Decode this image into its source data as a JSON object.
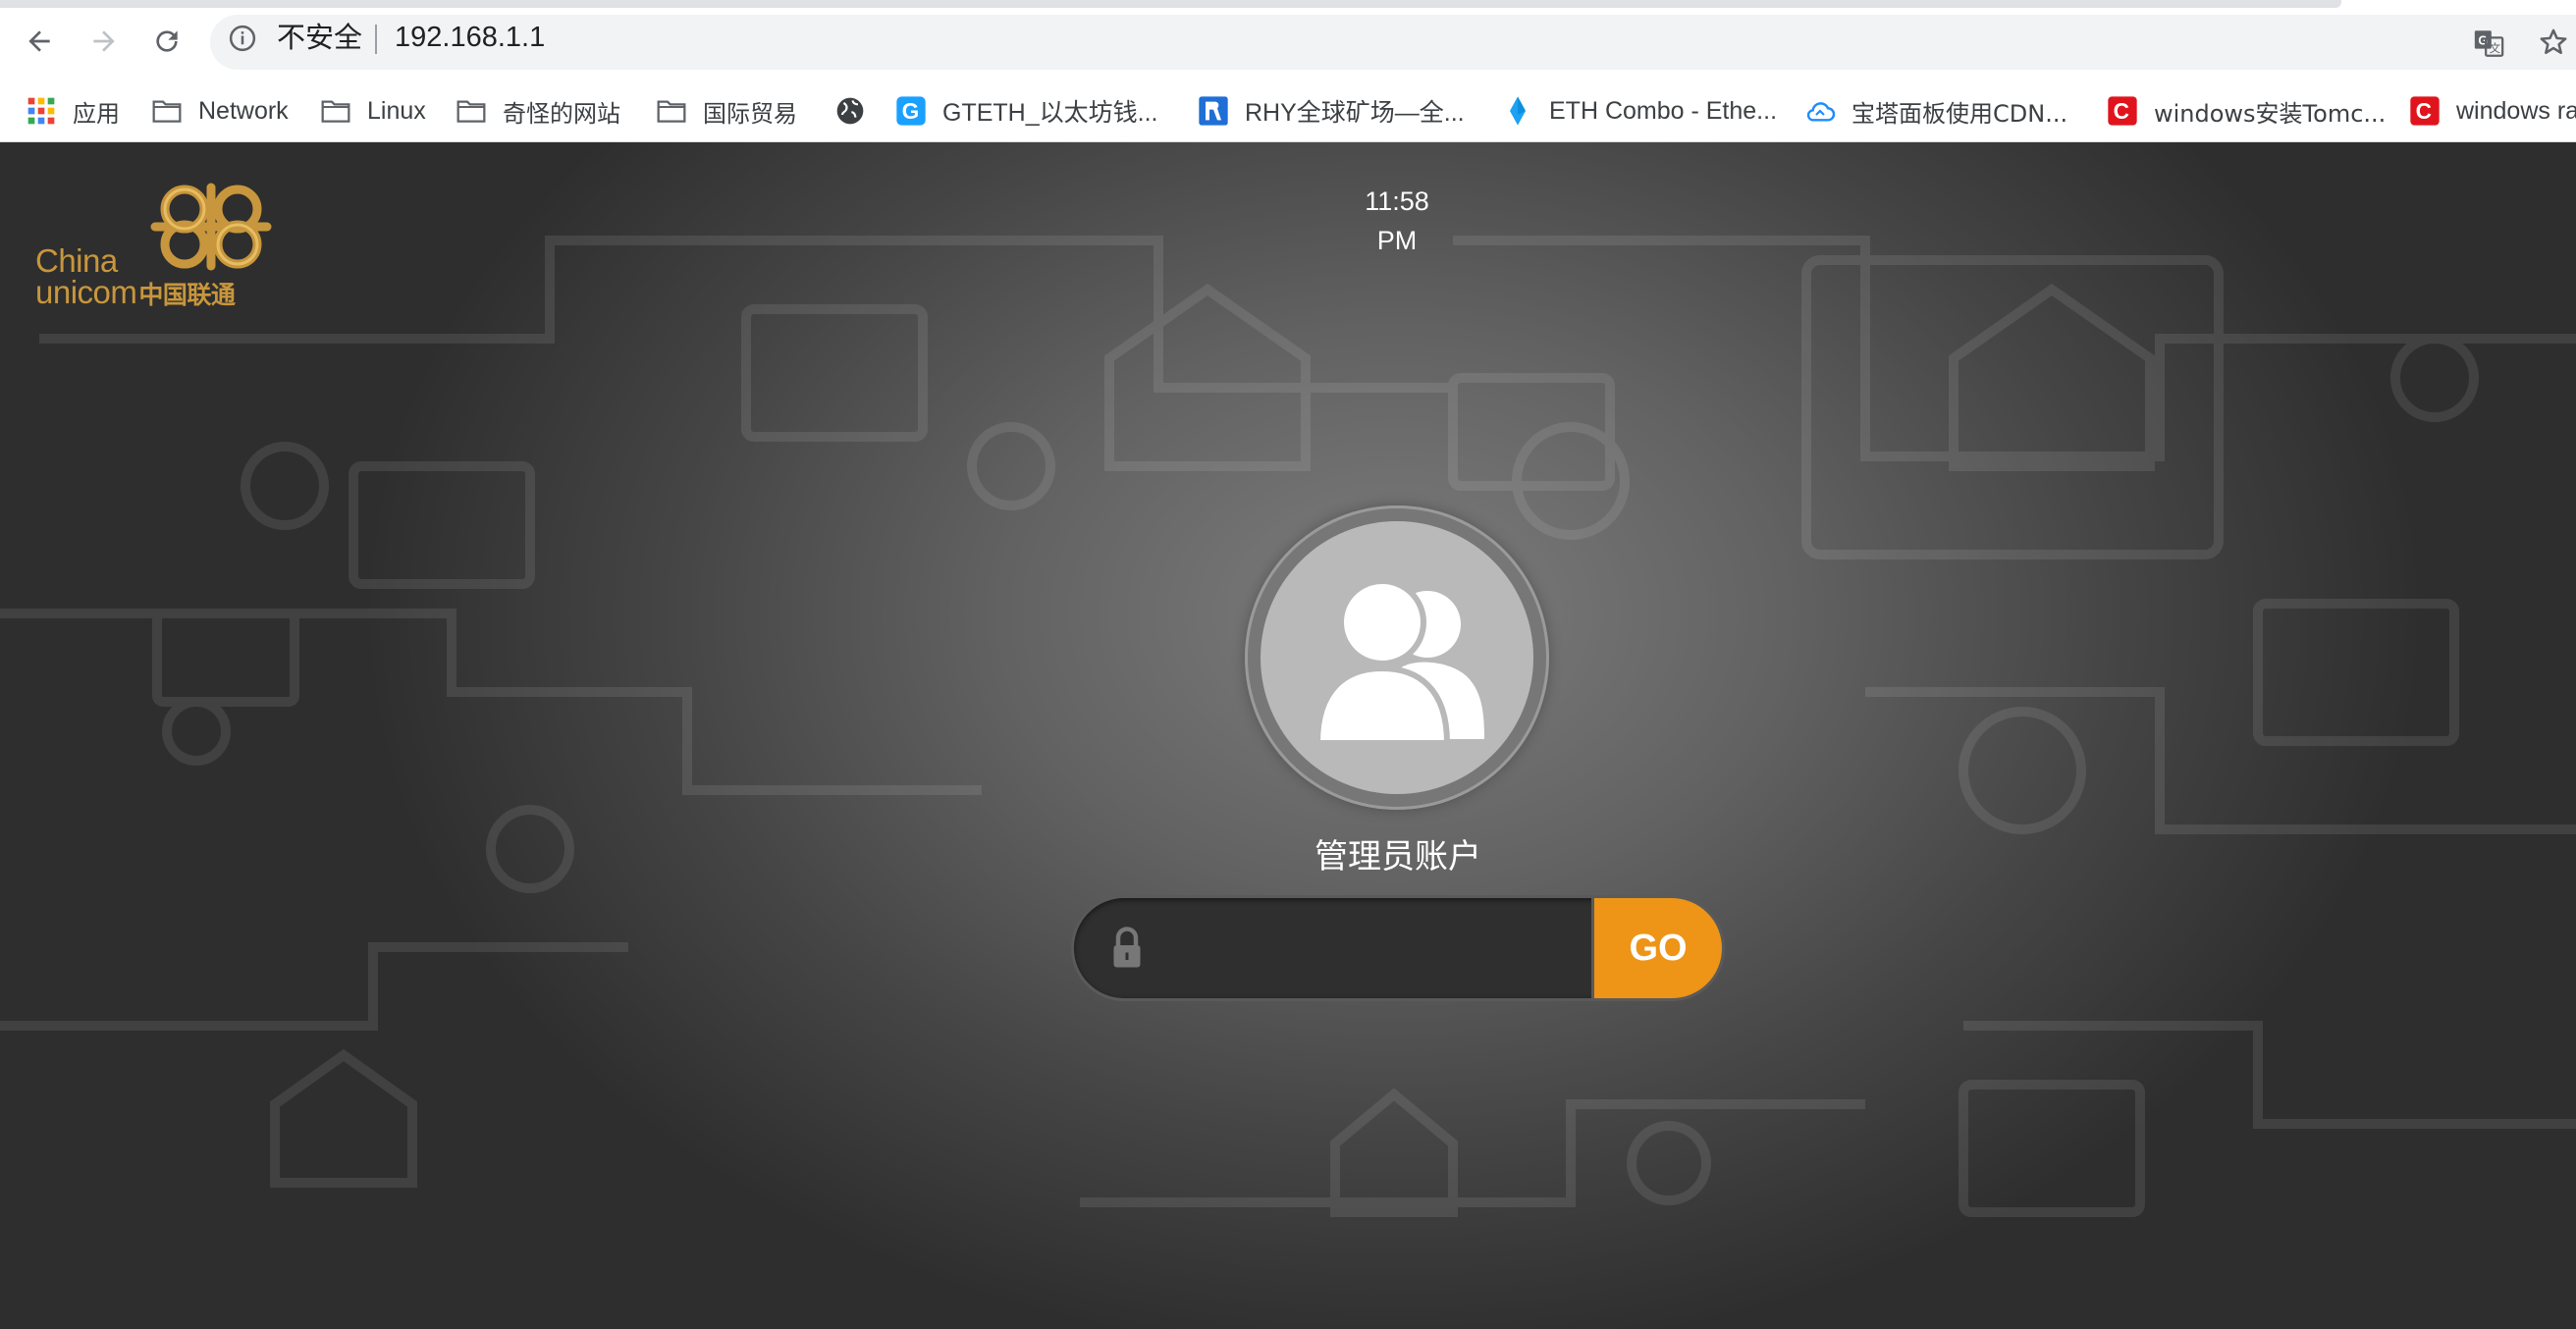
{
  "browser": {
    "back_icon": "arrow-left-icon",
    "forward_icon": "arrow-right-icon",
    "reload_icon": "reload-icon",
    "security_label": "不安全",
    "url": "192.168.1.1"
  },
  "bookmarks": {
    "items": [
      {
        "label": "应用",
        "icon": "apps-grid-icon"
      },
      {
        "label": "Network",
        "icon": "folder-icon"
      },
      {
        "label": "Linux",
        "icon": "folder-icon"
      },
      {
        "label": "奇怪的网站",
        "icon": "folder-icon"
      },
      {
        "label": "国际贸易",
        "icon": "folder-icon"
      },
      {
        "label": "",
        "icon": "globe-icon"
      },
      {
        "label": "GTETH_以太坊钱...",
        "icon": "gteth-icon"
      },
      {
        "label": "RHY全球矿场—全...",
        "icon": "rhy-icon"
      },
      {
        "label": "ETH Combo - Ethe...",
        "icon": "ethereum-icon"
      },
      {
        "label": "宝塔面板使用CDN...",
        "icon": "cloud-icon"
      },
      {
        "label": "windows安装Tomc...",
        "icon": "csdn-icon"
      },
      {
        "label": "windows ra",
        "icon": "csdn-icon"
      }
    ]
  },
  "page": {
    "logo_text_line1": "China",
    "logo_text_line2": "unicom",
    "logo_text_cn": "中国联通",
    "clock_time": "11:58",
    "clock_ampm": "PM",
    "account_label": "管理员账户",
    "password_placeholder": "",
    "go_label": "GO"
  },
  "colors": {
    "accent": "#ee9417",
    "logo_gold": "#c8963c"
  }
}
